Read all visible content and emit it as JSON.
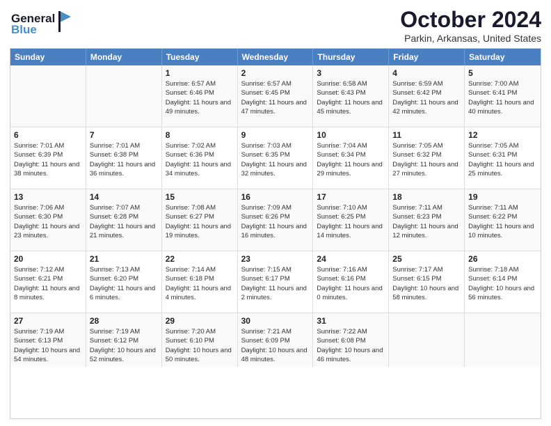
{
  "header": {
    "logo_line1": "General",
    "logo_line2": "Blue",
    "main_title": "October 2024",
    "subtitle": "Parkin, Arkansas, United States"
  },
  "weekdays": [
    "Sunday",
    "Monday",
    "Tuesday",
    "Wednesday",
    "Thursday",
    "Friday",
    "Saturday"
  ],
  "rows": [
    [
      {
        "day": "",
        "info": ""
      },
      {
        "day": "",
        "info": ""
      },
      {
        "day": "1",
        "info": "Sunrise: 6:57 AM\nSunset: 6:46 PM\nDaylight: 11 hours and 49 minutes."
      },
      {
        "day": "2",
        "info": "Sunrise: 6:57 AM\nSunset: 6:45 PM\nDaylight: 11 hours and 47 minutes."
      },
      {
        "day": "3",
        "info": "Sunrise: 6:58 AM\nSunset: 6:43 PM\nDaylight: 11 hours and 45 minutes."
      },
      {
        "day": "4",
        "info": "Sunrise: 6:59 AM\nSunset: 6:42 PM\nDaylight: 11 hours and 42 minutes."
      },
      {
        "day": "5",
        "info": "Sunrise: 7:00 AM\nSunset: 6:41 PM\nDaylight: 11 hours and 40 minutes."
      }
    ],
    [
      {
        "day": "6",
        "info": "Sunrise: 7:01 AM\nSunset: 6:39 PM\nDaylight: 11 hours and 38 minutes."
      },
      {
        "day": "7",
        "info": "Sunrise: 7:01 AM\nSunset: 6:38 PM\nDaylight: 11 hours and 36 minutes."
      },
      {
        "day": "8",
        "info": "Sunrise: 7:02 AM\nSunset: 6:36 PM\nDaylight: 11 hours and 34 minutes."
      },
      {
        "day": "9",
        "info": "Sunrise: 7:03 AM\nSunset: 6:35 PM\nDaylight: 11 hours and 32 minutes."
      },
      {
        "day": "10",
        "info": "Sunrise: 7:04 AM\nSunset: 6:34 PM\nDaylight: 11 hours and 29 minutes."
      },
      {
        "day": "11",
        "info": "Sunrise: 7:05 AM\nSunset: 6:32 PM\nDaylight: 11 hours and 27 minutes."
      },
      {
        "day": "12",
        "info": "Sunrise: 7:05 AM\nSunset: 6:31 PM\nDaylight: 11 hours and 25 minutes."
      }
    ],
    [
      {
        "day": "13",
        "info": "Sunrise: 7:06 AM\nSunset: 6:30 PM\nDaylight: 11 hours and 23 minutes."
      },
      {
        "day": "14",
        "info": "Sunrise: 7:07 AM\nSunset: 6:28 PM\nDaylight: 11 hours and 21 minutes."
      },
      {
        "day": "15",
        "info": "Sunrise: 7:08 AM\nSunset: 6:27 PM\nDaylight: 11 hours and 19 minutes."
      },
      {
        "day": "16",
        "info": "Sunrise: 7:09 AM\nSunset: 6:26 PM\nDaylight: 11 hours and 16 minutes."
      },
      {
        "day": "17",
        "info": "Sunrise: 7:10 AM\nSunset: 6:25 PM\nDaylight: 11 hours and 14 minutes."
      },
      {
        "day": "18",
        "info": "Sunrise: 7:11 AM\nSunset: 6:23 PM\nDaylight: 11 hours and 12 minutes."
      },
      {
        "day": "19",
        "info": "Sunrise: 7:11 AM\nSunset: 6:22 PM\nDaylight: 11 hours and 10 minutes."
      }
    ],
    [
      {
        "day": "20",
        "info": "Sunrise: 7:12 AM\nSunset: 6:21 PM\nDaylight: 11 hours and 8 minutes."
      },
      {
        "day": "21",
        "info": "Sunrise: 7:13 AM\nSunset: 6:20 PM\nDaylight: 11 hours and 6 minutes."
      },
      {
        "day": "22",
        "info": "Sunrise: 7:14 AM\nSunset: 6:18 PM\nDaylight: 11 hours and 4 minutes."
      },
      {
        "day": "23",
        "info": "Sunrise: 7:15 AM\nSunset: 6:17 PM\nDaylight: 11 hours and 2 minutes."
      },
      {
        "day": "24",
        "info": "Sunrise: 7:16 AM\nSunset: 6:16 PM\nDaylight: 11 hours and 0 minutes."
      },
      {
        "day": "25",
        "info": "Sunrise: 7:17 AM\nSunset: 6:15 PM\nDaylight: 10 hours and 58 minutes."
      },
      {
        "day": "26",
        "info": "Sunrise: 7:18 AM\nSunset: 6:14 PM\nDaylight: 10 hours and 56 minutes."
      }
    ],
    [
      {
        "day": "27",
        "info": "Sunrise: 7:19 AM\nSunset: 6:13 PM\nDaylight: 10 hours and 54 minutes."
      },
      {
        "day": "28",
        "info": "Sunrise: 7:19 AM\nSunset: 6:12 PM\nDaylight: 10 hours and 52 minutes."
      },
      {
        "day": "29",
        "info": "Sunrise: 7:20 AM\nSunset: 6:10 PM\nDaylight: 10 hours and 50 minutes."
      },
      {
        "day": "30",
        "info": "Sunrise: 7:21 AM\nSunset: 6:09 PM\nDaylight: 10 hours and 48 minutes."
      },
      {
        "day": "31",
        "info": "Sunrise: 7:22 AM\nSunset: 6:08 PM\nDaylight: 10 hours and 46 minutes."
      },
      {
        "day": "",
        "info": ""
      },
      {
        "day": "",
        "info": ""
      }
    ]
  ]
}
